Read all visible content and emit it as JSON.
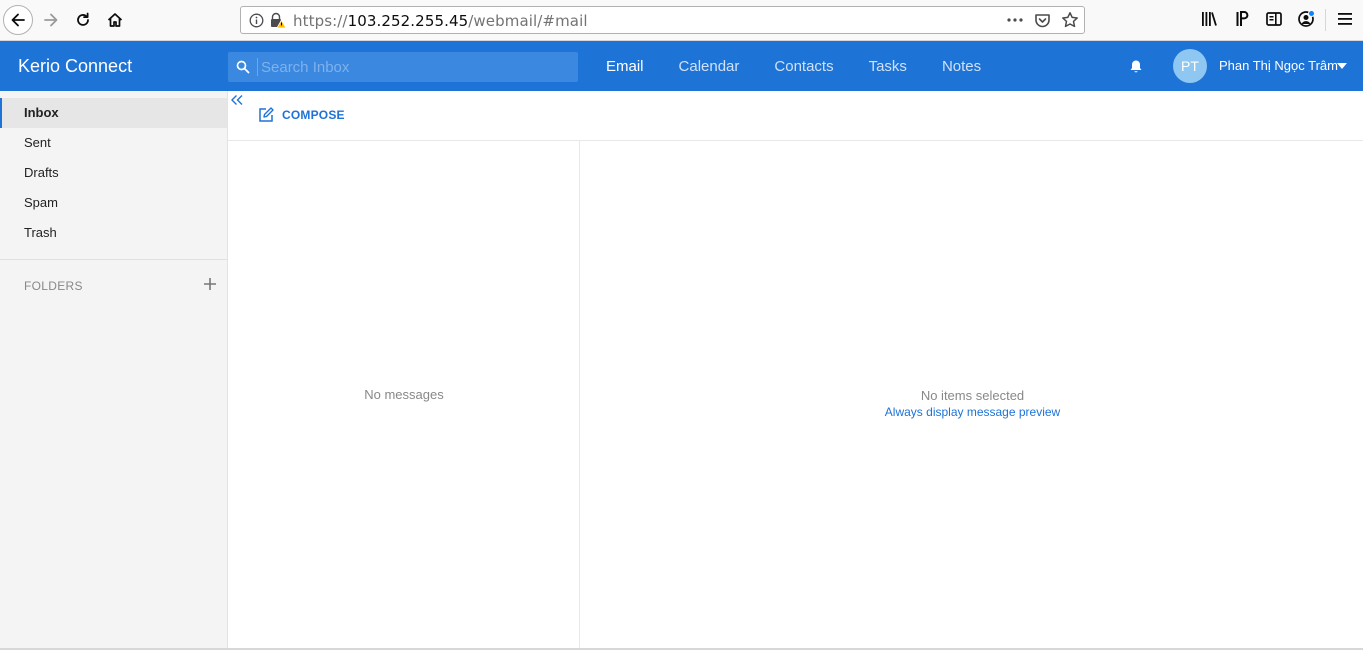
{
  "browser": {
    "url_prefix": "https://",
    "url_host": "103.252.255.45",
    "url_path": "/webmail/#mail",
    "icons": [
      "back-icon",
      "forward-icon",
      "reload-icon",
      "home-icon",
      "info-icon",
      "insecure-lock-icon",
      "more-icon",
      "pocket-icon",
      "bookmark-star-icon",
      "library-icon",
      "ip-icon",
      "reader-view-icon",
      "account-icon",
      "hamburger-menu-icon"
    ]
  },
  "header": {
    "brand": "Kerio Connect",
    "search_placeholder": "Search Inbox",
    "nav": [
      "Email",
      "Calendar",
      "Contacts",
      "Tasks",
      "Notes"
    ],
    "active_nav": "Email",
    "user_initials": "PT",
    "user_name": "Phan Thị Ngọc Trâm",
    "accent_color": "#1e73d6"
  },
  "sidebar": {
    "items": [
      "Inbox",
      "Sent",
      "Drafts",
      "Spam",
      "Trash"
    ],
    "active": "Inbox",
    "folders_heading": "FOLDERS"
  },
  "toolbar": {
    "compose_label": "COMPOSE"
  },
  "message_list": {
    "empty_text": "No messages"
  },
  "preview": {
    "empty_text": "No items selected",
    "link_text": "Always display message preview"
  }
}
